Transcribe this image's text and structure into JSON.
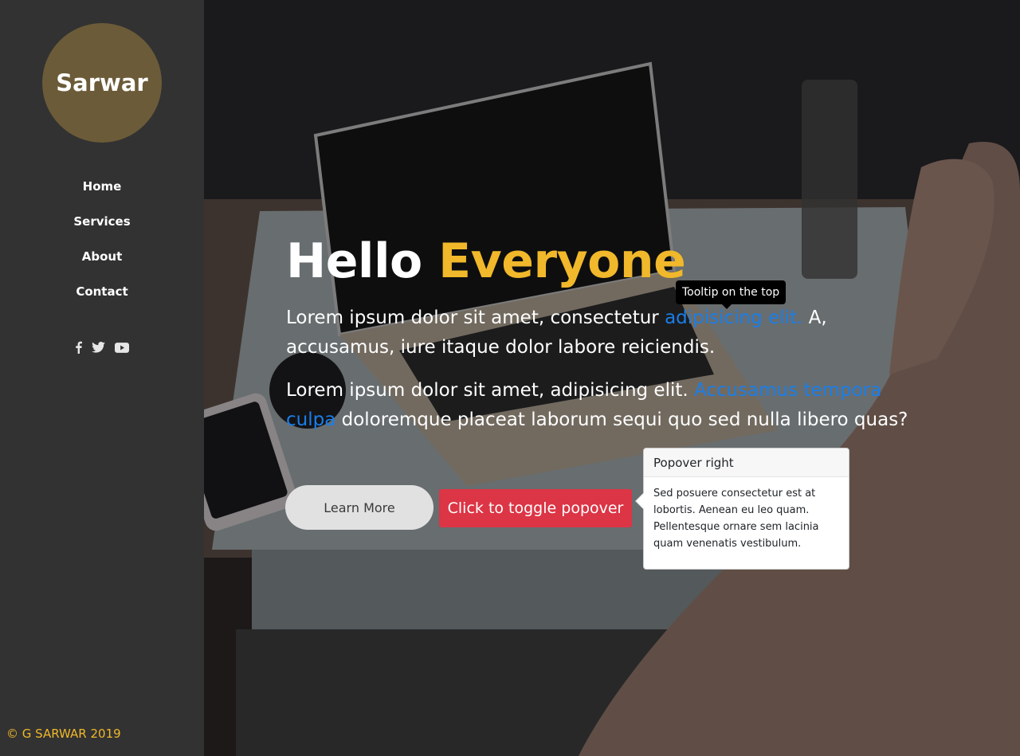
{
  "sidebar": {
    "logo": "Sarwar",
    "nav": [
      {
        "label": "Home"
      },
      {
        "label": "Services"
      },
      {
        "label": "About"
      },
      {
        "label": "Contact"
      }
    ],
    "social": [
      "facebook-icon",
      "twitter-icon",
      "youtube-icon"
    ],
    "copyright": "© G SARWAR 2019"
  },
  "hero": {
    "heading_prefix": "Hello",
    "heading_accent": "Everyone",
    "heading_cursor": "_",
    "para1_start": "Lorem ipsum dolor sit amet, consectetur",
    "para1_link": "adipisicing elit.",
    "para1_end": "A, accusamus, iure itaque dolor labore reiciendis.",
    "para2_start": "Lorem ipsum dolor sit amet, adipisicing elit.",
    "para2_link": "Accusamus tempora culpa",
    "para2_end": "doloremque placeat laborum sequi quo sed nulla libero quas?",
    "learn_more": "Learn More",
    "popover_button": "Click to toggle popover"
  },
  "tooltip": {
    "text": "Tooltip on the top"
  },
  "popover": {
    "title": "Popover right",
    "body": "Sed posuere consectetur est at lobortis. Aenean eu leo quam. Pellentesque ornare sem lacinia quam venenatis vestibulum."
  },
  "colors": {
    "sidebar": "#323232",
    "accent": "#f0b82a",
    "link": "#1a7ee8",
    "danger": "#dc3545"
  }
}
